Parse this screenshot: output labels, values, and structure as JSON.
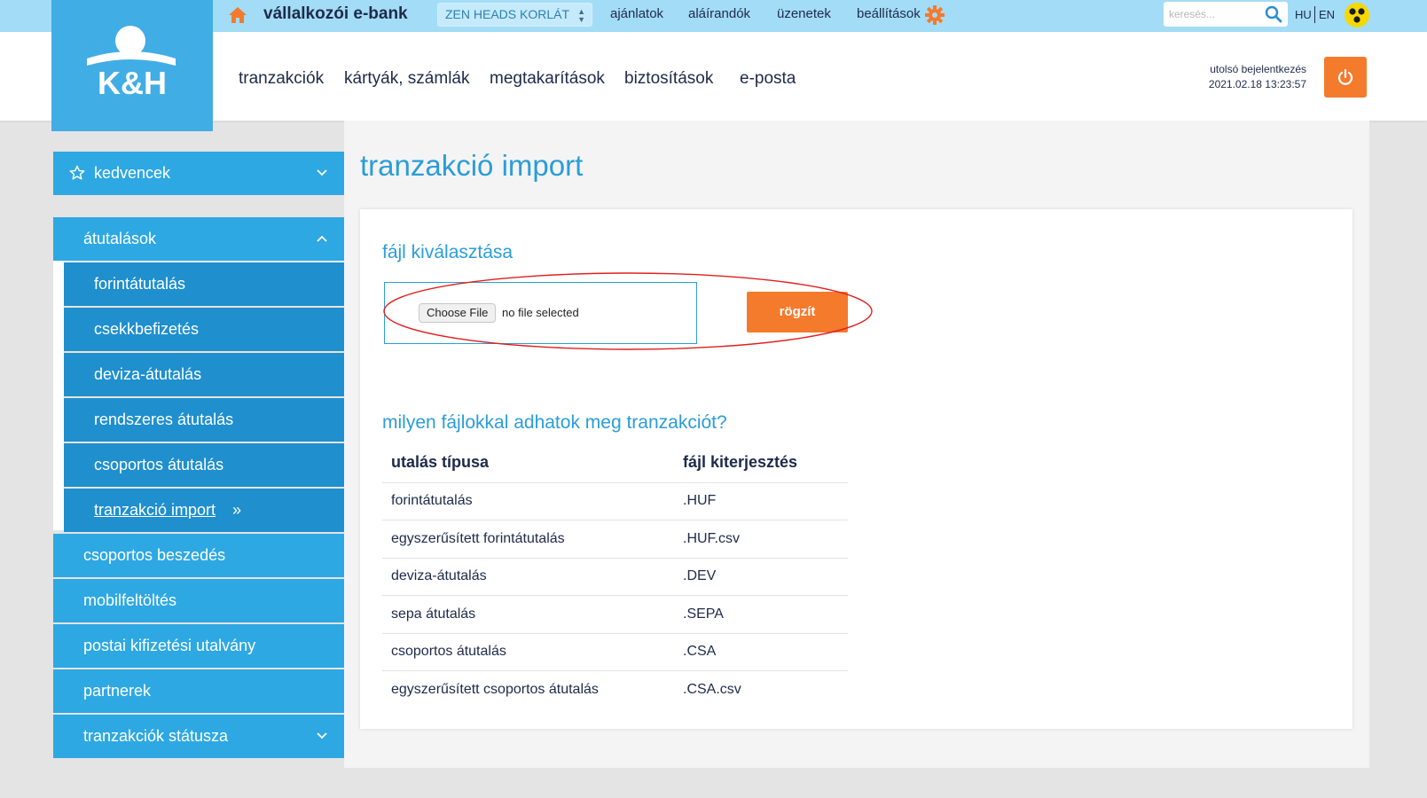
{
  "topbar": {
    "title": "vállalkozói e-bank",
    "company_select": "ZEN HEADS KORLÁT",
    "nav": [
      "ajánlatok",
      "aláírandók",
      "üzenetek",
      "beállítások"
    ],
    "search_placeholder": "keresés...",
    "lang_hu": "HU",
    "lang_en": "EN",
    "icons": [
      "home-icon",
      "gear-icon",
      "search-icon",
      "accessibility-icon"
    ]
  },
  "header": {
    "logo_text": "K&H",
    "nav": [
      "tranzakciók",
      "kártyák, számlák",
      "megtakarítások",
      "biztosítások",
      "e-posta"
    ],
    "last_login_label": "utolsó bejelentkezés",
    "last_login_value": "2021.02.18 13:23:57"
  },
  "sidebar": {
    "favorites": "kedvencek",
    "transfers": "átutalások",
    "sub_items": [
      "forintátutalás",
      "csekkbefizetés",
      "deviza-átutalás",
      "rendszeres átutalás",
      "csoportos átutalás",
      "tranzakció import"
    ],
    "active_sub": "tranzakció import",
    "items": [
      "csoportos beszedés",
      "mobilfeltöltés",
      "postai kifizetési utalvány",
      "partnerek",
      "tranzakciók státusza"
    ]
  },
  "main": {
    "page_title": "tranzakció import",
    "file_section_title": "fájl kiválasztása",
    "choose_file_label": "Choose File",
    "file_status": "no file selected",
    "submit_label": "rögzít",
    "info_title": "milyen fájlokkal adhatok meg tranzakciót?",
    "table": {
      "headers": [
        "utalás típusa",
        "fájl kiterjesztés"
      ],
      "rows": [
        [
          "forintátutalás",
          ".HUF"
        ],
        [
          "egyszerűsített forintátutalás",
          ".HUF.csv"
        ],
        [
          "deviza-átutalás",
          ".DEV"
        ],
        [
          "sepa átutalás",
          ".SEPA"
        ],
        [
          "csoportos átutalás",
          ".CSA"
        ],
        [
          "egyszerűsített csoportos átutalás",
          ".CSA.csv"
        ]
      ]
    }
  },
  "colors": {
    "topbar": "#a3dcf7",
    "brand_blue": "#41ade5",
    "sidebar_blue": "#2ea8e3",
    "sidebar_sub": "#1f8fce",
    "title_blue": "#2b9dd8",
    "accent_orange": "#f47a2c",
    "annotation_red": "#e0201e"
  }
}
